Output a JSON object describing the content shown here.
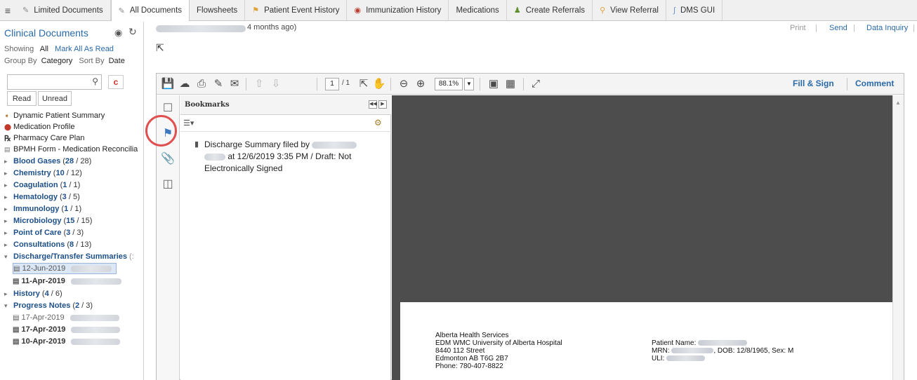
{
  "tabs": [
    {
      "label": "Limited Documents",
      "icon": "document-icon"
    },
    {
      "label": "All Documents",
      "icon": "document-icon",
      "active": true
    },
    {
      "label": "Flowsheets",
      "icon": ""
    },
    {
      "label": "Patient Event History",
      "icon": "event-icon"
    },
    {
      "label": "Immunization History",
      "icon": "immunization-icon"
    },
    {
      "label": "Medications",
      "icon": ""
    },
    {
      "label": "Create Referrals",
      "icon": "referral-icon"
    },
    {
      "label": "View Referral",
      "icon": "view-referral-icon"
    },
    {
      "label": "DMS GUI",
      "icon": "dms-icon"
    }
  ],
  "sidebar": {
    "title": "Clinical Documents",
    "showing_label": "Showing",
    "showing_all": "All",
    "mark_all_read": "Mark All As Read",
    "group_by_label": "Group By",
    "group_by_category": "Category",
    "sort_by_label": "Sort By",
    "sort_by_date": "Date",
    "clear_label": "c",
    "read_label": "Read",
    "unread_label": "Unread",
    "links": [
      {
        "label": "Dynamic Patient Summary",
        "icon": "summary-icon"
      },
      {
        "label": "Medication Profile",
        "icon": "pill-icon"
      },
      {
        "label": "Pharmacy Care Plan",
        "icon": "rx-icon"
      },
      {
        "label": "BPMH Form - Medication Reconcilia",
        "icon": "form-icon"
      }
    ],
    "categories": [
      {
        "name": "Blood Gases",
        "unread": "28",
        "total": "28"
      },
      {
        "name": "Chemistry",
        "unread": "10",
        "total": "12"
      },
      {
        "name": "Coagulation",
        "unread": "1",
        "total": "1"
      },
      {
        "name": "Hematology",
        "unread": "3",
        "total": "5"
      },
      {
        "name": "Immunology",
        "unread": "1",
        "total": "1"
      },
      {
        "name": "Microbiology",
        "unread": "15",
        "total": "15"
      },
      {
        "name": "Point of Care",
        "unread": "3",
        "total": "3"
      },
      {
        "name": "Consultations",
        "unread": "8",
        "total": "13"
      },
      {
        "name": "Discharge/Transfer Summaries",
        "suffix": "(:"
      },
      {
        "name": "History",
        "unread": "4",
        "total": "6"
      },
      {
        "name": "Progress Notes",
        "unread": "2",
        "total": "3"
      }
    ],
    "discharge_docs": [
      {
        "date": "12-Jun-2019"
      },
      {
        "date": "11-Apr-2019"
      }
    ],
    "progress_docs": [
      {
        "date": "17-Apr-2019"
      },
      {
        "date": "17-Apr-2019"
      },
      {
        "date": "10-Apr-2019"
      }
    ]
  },
  "header": {
    "subtitle_suffix": "4 months ago)",
    "print_label": "Print",
    "send_label": "Send",
    "data_inquiry_label": "Data Inquiry",
    "sep": "|"
  },
  "viewer": {
    "page_current": "1",
    "page_total": "/ 1",
    "zoom": "88.1%",
    "fill_sign": "Fill & Sign",
    "comment": "Comment",
    "bookmarks_title": "Bookmarks",
    "bookmark_line1": "Discharge Summary filed by",
    "bookmark_line2": "at 12/6/2019  3:35 PM / Draft: Not",
    "bookmark_line3": "Electronically Signed"
  },
  "pdf_page": {
    "org_line1": "Alberta Health Services",
    "org_line2": "EDM WMC University of Alberta Hospital",
    "org_line3": "8440 112 Street",
    "org_line4": "Edmonton AB T6G 2B7",
    "org_line5": "Phone: 780-407-8822",
    "patient_name_label": "Patient Name:",
    "mrn_label": "MRN:",
    "mrn_suffix": ", DOB: 12/8/1965, Sex: M",
    "uli_label": "ULI:"
  },
  "colors": {
    "link_blue": "#2a6aa8",
    "category_blue": "#1d4f88",
    "highlight_red": "#e05050",
    "pdf_background": "#4d4d4d"
  }
}
